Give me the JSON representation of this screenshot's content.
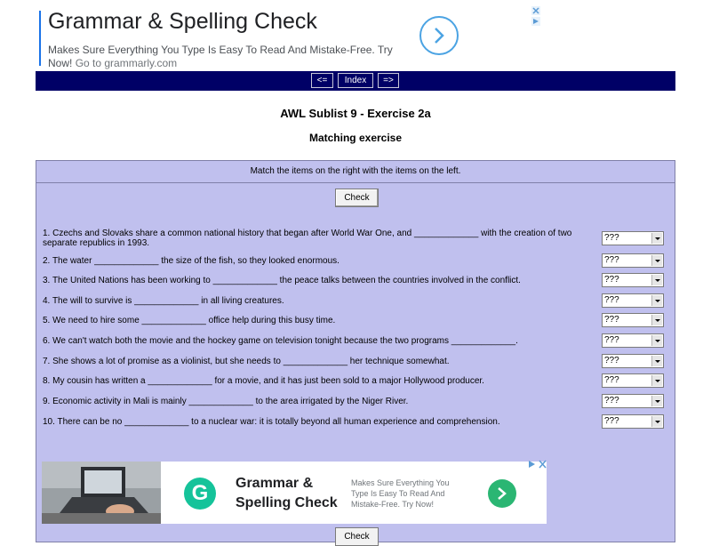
{
  "top_ad": {
    "title": "Grammar & Spelling Check",
    "description": "Makes Sure Everything You Type Is Easy To Read And Mistake-Free. Try Now!",
    "link_text": "Go to grammarly.com"
  },
  "nav": {
    "prev": "<=",
    "index": "Index",
    "next": "=>"
  },
  "page": {
    "title": "AWL Sublist 9 - Exercise 2a",
    "subtitle": "Matching exercise"
  },
  "exercise": {
    "instruction": "Match the items on the right with the items on the left.",
    "check_label": "Check",
    "default_option": "???",
    "questions": [
      "1. Czechs and Slovaks share a common national history that began after World War One, and _____________ with the creation of two separate republics in 1993.",
      "2. The water _____________ the size of the fish, so they looked enormous.",
      "3. The United Nations has been working to _____________ the peace talks between the countries involved in the conflict.",
      "4. The will to survive is _____________ in all living creatures.",
      "5. We need to hire some _____________ office help during this busy time.",
      "6. We can't watch both the movie and the hockey game on television tonight because the two programs _____________.",
      "7. She shows a lot of promise as a violinist, but she needs to _____________ her technique somewhat.",
      "8. My cousin has written a _____________ for a movie, and it has just been sold to a major Hollywood producer.",
      "9. Economic activity in Mali is mainly _____________ to the area irrigated by the Niger River.",
      "10. There can be no _____________ to a nuclear war: it is totally beyond all human experience and comprehension."
    ]
  },
  "bottom_ad": {
    "logo_letter": "G",
    "headline": "Grammar & Spelling Check",
    "description": "Makes Sure Everything You Type Is Easy To Read And Mistake-Free. Try Now!"
  },
  "colors": {
    "nav_bg": "#000066",
    "panel_bg": "#c0c0ee",
    "ad_accent": "#4ba3e3",
    "grammarly_green": "#15c39a"
  }
}
